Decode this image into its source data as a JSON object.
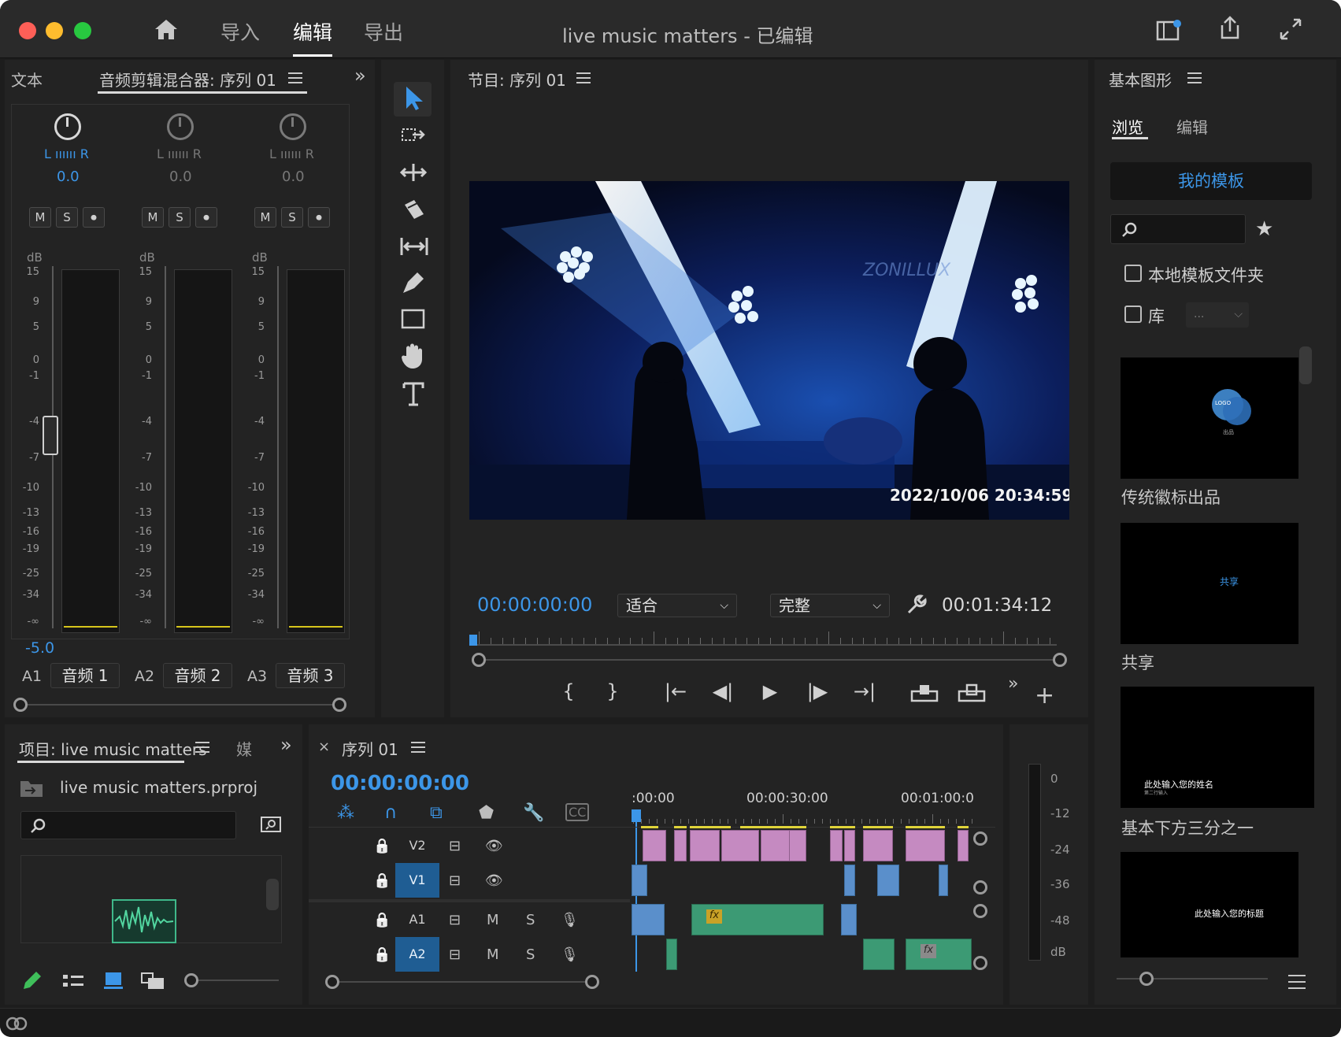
{
  "titlebar": {
    "nav": [
      "导入",
      "编辑",
      "导出"
    ],
    "active_nav": "编辑",
    "title": "live music matters - 已编辑"
  },
  "mixer": {
    "tab_left": "文本",
    "tab_active": "音频剪辑混合器: 序列 01",
    "channels": [
      {
        "pan_label": "L ıııııı R",
        "pan_value": "0.0",
        "volume": "-5.0",
        "track": "A1",
        "name": "音频 1",
        "active": true
      },
      {
        "pan_label": "L ıııııı R",
        "pan_value": "0.0",
        "volume": "",
        "track": "A2",
        "name": "音频 2",
        "active": false
      },
      {
        "pan_label": "L ıııııı R",
        "pan_value": "0.0",
        "volume": "",
        "track": "A3",
        "name": "音频 3",
        "active": false
      }
    ],
    "buttons": [
      "M",
      "S",
      "⏺"
    ],
    "db_label": "dB",
    "db_ticks": [
      "15",
      "9",
      "5",
      "0",
      "-1",
      "-4",
      "-7",
      "-10",
      "-13",
      "-16",
      "-19",
      "-25",
      "-34",
      "-∞"
    ]
  },
  "tools": [
    "selection-tool",
    "track-select-tool",
    "ripple-edit-tool",
    "razor-tool",
    "slip-tool",
    "pen-tool",
    "rectangle-tool",
    "hand-tool",
    "type-tool"
  ],
  "program": {
    "title": "节目: 序列 01",
    "overlay_timestamp": "2022/10/06  20:34:59",
    "overlay_brand": "ZONILLUX",
    "timecode": "00:00:00:00",
    "fit": "适合",
    "quality": "完整",
    "duration": "00:01:34:12"
  },
  "graphics": {
    "title": "基本图形",
    "tabs": [
      "浏览",
      "编辑"
    ],
    "my_templates": "我的模板",
    "checkbox_local": "本地模板文件夹",
    "checkbox_lib": "库",
    "lib_select": "...",
    "templates": [
      {
        "label": "传统徽标出品",
        "inner": "LOGO",
        "sub": "出品"
      },
      {
        "label": "共享",
        "inner": "共享",
        "sub": ""
      },
      {
        "label": "基本下方三分之一",
        "inner": "此处输入您的姓名",
        "sub": "第二行输入"
      },
      {
        "label": "",
        "inner": "此处输入您的标题",
        "sub": ""
      }
    ]
  },
  "project": {
    "title": "项目: live music matters",
    "tab2": "媒",
    "file": "live music matters.prproj"
  },
  "timeline": {
    "title": "序列 01",
    "timecode": "00:00:00:00",
    "ruler": [
      ":00:00",
      "00:00:30:00",
      "00:01:00:0"
    ],
    "tracks": [
      {
        "id": "V2",
        "target": false,
        "type": "video"
      },
      {
        "id": "V1",
        "target": true,
        "type": "video"
      },
      {
        "id": "A1",
        "target": false,
        "type": "audio"
      },
      {
        "id": "A2",
        "target": true,
        "type": "audio"
      }
    ],
    "m": "M",
    "s": "S",
    "fx": "fx"
  },
  "meter": {
    "ticks": [
      "0",
      "-12",
      "-24",
      "-36",
      "-48",
      "dB"
    ]
  },
  "colors": {
    "accent": "#3c96e8",
    "video_clip": "#c58ac1",
    "video_clip_v1": "#5a8fcb",
    "audio_clip": "#3c9a74",
    "target_track": "#1f5d93"
  }
}
